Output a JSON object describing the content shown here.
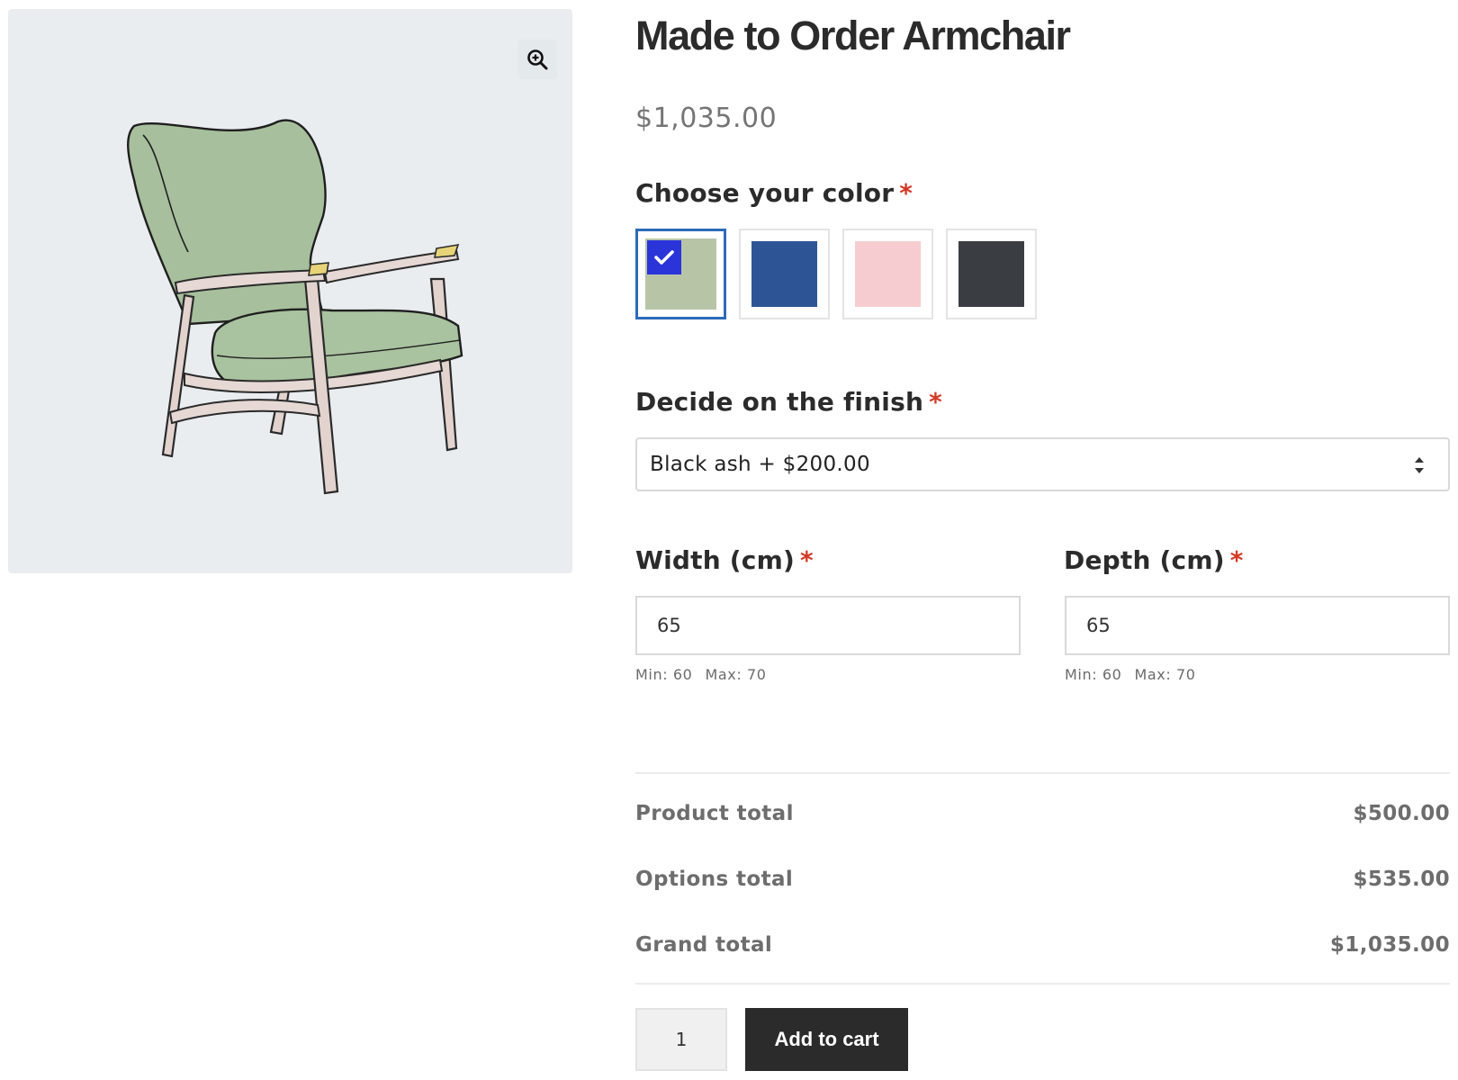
{
  "product": {
    "title": "Made to Order Armchair",
    "price": "$1,035.00",
    "image_icon": "armchair-illustration",
    "zoom_icon": "zoom-in-icon"
  },
  "color": {
    "label": "Choose your color",
    "required_mark": "*",
    "swatches": [
      {
        "color": "#b7c5a6",
        "selected": true
      },
      {
        "color": "#2d5596",
        "selected": false
      },
      {
        "color": "#f6ccd0",
        "selected": false
      },
      {
        "color": "#3a3e42",
        "selected": false
      }
    ],
    "selected_accent": "#2d6bb9",
    "check_bg": "#2a34d8"
  },
  "finish": {
    "label": "Decide on the finish",
    "required_mark": "*",
    "selected_value": "Black ash + $200.00"
  },
  "width": {
    "label": "Width (cm)",
    "required_mark": "*",
    "value": "65",
    "min": "Min: 60",
    "max": "Max: 70"
  },
  "depth": {
    "label": "Depth (cm)",
    "required_mark": "*",
    "value": "65",
    "min": "Min: 60",
    "max": "Max: 70"
  },
  "totals": {
    "product_label": "Product total",
    "product_value": "$500.00",
    "options_label": "Options total",
    "options_value": "$535.00",
    "grand_label": "Grand total",
    "grand_value": "$1,035.00"
  },
  "cart": {
    "quantity": "1",
    "button_label": "Add to cart"
  },
  "colors": {
    "required": "#d33a26",
    "button_bg": "#2b2b2b"
  }
}
